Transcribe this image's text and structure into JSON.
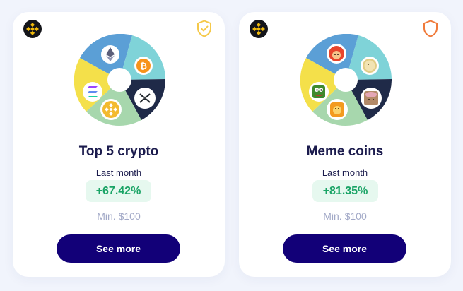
{
  "cards": [
    {
      "title": "Top 5 crypto",
      "period": "Last month",
      "change": "+67.42%",
      "min": "Min. $100",
      "button": "See more",
      "shield_color": "#f5c94a",
      "icons": [
        "ethereum-icon",
        "bitcoin-icon",
        "xrp-icon",
        "bnb-icon",
        "solana-icon"
      ]
    },
    {
      "title": "Meme coins",
      "period": "Last month",
      "change": "+81.35%",
      "min": "Min. $100",
      "button": "See more",
      "shield_color": "#f07a3a",
      "icons": [
        "shiba-icon",
        "dogecoin-icon",
        "dog-hat-icon",
        "bonk-icon",
        "pepe-icon"
      ]
    }
  ],
  "colors": {
    "segment_blue": "#5b9fd6",
    "segment_teal": "#7fd3d8",
    "segment_navy": "#1f2a48",
    "segment_green": "#a7d7ad",
    "segment_yellow": "#f4e04a",
    "button_bg": "#120078",
    "change_text": "#1aa466"
  }
}
